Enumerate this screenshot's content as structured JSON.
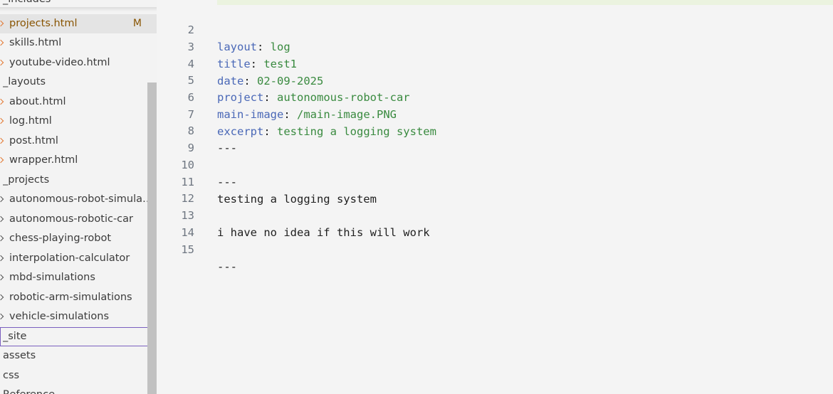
{
  "sidebar": {
    "top_folder": "_includes",
    "items": [
      {
        "label": "projects.html",
        "badge": "M"
      },
      {
        "label": "skills.html"
      },
      {
        "label": "youtube-video.html"
      },
      {
        "label": "_layouts"
      },
      {
        "label": "about.html"
      },
      {
        "label": "log.html"
      },
      {
        "label": "post.html"
      },
      {
        "label": "wrapper.html"
      },
      {
        "label": "_projects"
      },
      {
        "label": "autonomous-robot-simulations"
      },
      {
        "label": "autonomous-robotic-car"
      },
      {
        "label": "chess-playing-robot"
      },
      {
        "label": "interpolation-calculator"
      },
      {
        "label": "mbd-simulations"
      },
      {
        "label": "robotic-arm-simulations"
      },
      {
        "label": "vehicle-simulations"
      },
      {
        "label": "_site"
      },
      {
        "label": "assets"
      },
      {
        "label": "css"
      },
      {
        "label": "Reference"
      }
    ]
  },
  "editor": {
    "lines": [
      {
        "num": "2",
        "key": "layout",
        "value": "log"
      },
      {
        "num": "3",
        "key": "title",
        "value": "test1"
      },
      {
        "num": "4",
        "key": "date",
        "value": "02-09-2025"
      },
      {
        "num": "5",
        "key": "project",
        "value": "autonomous-robot-car"
      },
      {
        "num": "6",
        "key": "main-image",
        "value": "/main-image.PNG"
      },
      {
        "num": "7",
        "key": "excerpt",
        "value": "testing a logging system"
      },
      {
        "num": "8",
        "text": "---"
      },
      {
        "num": "9",
        "text": ""
      },
      {
        "num": "10",
        "text": "---"
      },
      {
        "num": "11",
        "text": "testing a logging system"
      },
      {
        "num": "12",
        "text": ""
      },
      {
        "num": "13",
        "text": "i have no idea if this will work"
      },
      {
        "num": "14",
        "text": ""
      },
      {
        "num": "15",
        "text": "---"
      }
    ]
  },
  "colors": {
    "yaml_key": "#4a68b7",
    "yaml_value": "#398a3f",
    "modified": "#895503",
    "html_icon": "#e37933"
  }
}
